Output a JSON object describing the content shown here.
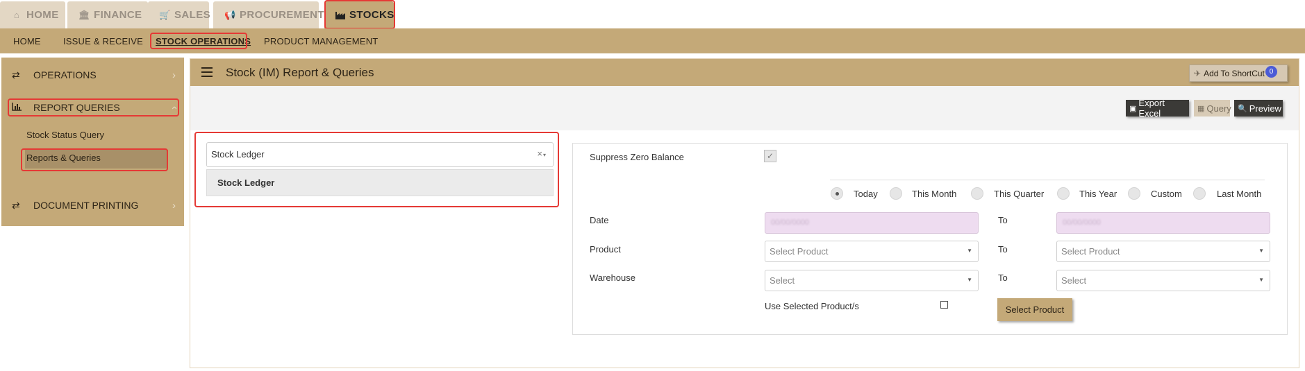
{
  "top_tabs": [
    {
      "label": "HOME",
      "icon": "home-icon"
    },
    {
      "label": "FINANCE",
      "icon": "bank-icon"
    },
    {
      "label": "SALES",
      "icon": "cart-icon"
    },
    {
      "label": "PROCUREMENT",
      "icon": "bullhorn-icon"
    },
    {
      "label": "STOCKS",
      "icon": "factory-icon",
      "active": true
    }
  ],
  "subnav": [
    {
      "label": "HOME"
    },
    {
      "label": "ISSUE & RECEIVE"
    },
    {
      "label": "STOCK OPERATIONS",
      "active": true
    },
    {
      "label": "PRODUCT MANAGEMENT"
    }
  ],
  "sidebar": {
    "operations": "OPERATIONS",
    "report_queries": "REPORT QUERIES",
    "sub_items": [
      "Stock Status Query",
      "Reports & Queries"
    ],
    "document_printing": "DOCUMENT PRINTING"
  },
  "panel": {
    "title": "Stock (IM) Report & Queries",
    "shortcut_label": "Add To ShortCut",
    "shortcut_count": "0",
    "export_excel": "Export Excel",
    "query": "Query",
    "preview": "Preview"
  },
  "report_select": {
    "value": "Stock Ledger",
    "clear": "×",
    "option": "Stock Ledger"
  },
  "form": {
    "suppress_zero_balance": "Suppress Zero Balance",
    "periods": [
      "Today",
      "This Month",
      "This Quarter",
      "This Year",
      "Custom",
      "Last Month"
    ],
    "selected_period": "Today",
    "date_label": "Date",
    "product_label": "Product",
    "warehouse_label": "Warehouse",
    "to_label": "To",
    "date_from": "00/00/0000",
    "date_to": "00/00/0000",
    "product_placeholder": "Select Product",
    "warehouse_placeholder": "Select",
    "use_selected_products": "Use Selected Product/s",
    "select_product_button": "Select Product"
  },
  "colors": {
    "accent": "#c4a978",
    "highlight": "#e53935",
    "badge": "#4b5bd6",
    "date_field": "#eedcf0"
  }
}
